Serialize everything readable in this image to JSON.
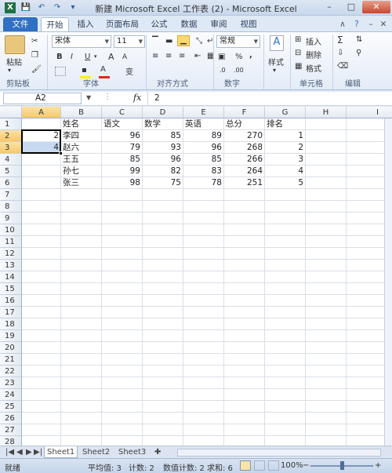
{
  "window": {
    "title": "新建 Microsoft Excel 工作表 (2) - Microsoft Excel"
  },
  "ribbon_tabs": [
    "文件",
    "开始",
    "插入",
    "页面布局",
    "公式",
    "数据",
    "审阅",
    "视图"
  ],
  "ribbon": {
    "paste_label": "粘贴",
    "font_name": "宋体",
    "font_size": "11",
    "bold": "B",
    "italic": "I",
    "underline": "U",
    "grow_font": "A",
    "shrink_font": "A",
    "font_color_glyph": "A",
    "wen": "变",
    "number_format": "常规",
    "percent": "%",
    "comma": ",",
    "style_label": "样式",
    "insert_label": "插入",
    "delete_label": "删除",
    "format_label": "格式",
    "sum_glyph": "Σ",
    "group_labels": {
      "clipboard": "剪贴板",
      "font": "字体",
      "alignment": "对齐方式",
      "number": "数字",
      "cells": "单元格",
      "editing": "编辑"
    }
  },
  "formula_bar": {
    "name_box": "A2",
    "fx": "fx",
    "value": "2"
  },
  "columns": [
    "A",
    "B",
    "C",
    "D",
    "E",
    "F",
    "G",
    "H",
    "I"
  ],
  "rows": [
    "1",
    "2",
    "3",
    "4",
    "5",
    "6",
    "7",
    "8",
    "9",
    "10",
    "11",
    "12",
    "13",
    "14",
    "15",
    "16",
    "17",
    "18",
    "19",
    "20",
    "21",
    "22",
    "23",
    "24",
    "25",
    "26",
    "27",
    "28"
  ],
  "cells": {
    "A2": "2",
    "A3": "4",
    "B1": "姓名",
    "C1": "语文",
    "D1": "数学",
    "E1": "英语",
    "F1": "总分",
    "G1": "排名",
    "B2": "李四",
    "C2": "96",
    "D2": "85",
    "E2": "89",
    "F2": "270",
    "G2": "1",
    "B3": "赵六",
    "C3": "79",
    "D3": "93",
    "E3": "96",
    "F3": "268",
    "G3": "2",
    "B4": "王五",
    "C4": "85",
    "D4": "96",
    "E4": "85",
    "F4": "266",
    "G4": "3",
    "B5": "孙七",
    "C5": "99",
    "D5": "82",
    "E5": "83",
    "F5": "264",
    "G5": "4",
    "B6": "张三",
    "C6": "98",
    "D6": "75",
    "E6": "78",
    "F6": "251",
    "G6": "5"
  },
  "sheet_tabs": [
    "Sheet1",
    "Sheet2",
    "Sheet3"
  ],
  "status": {
    "ready": "就绪",
    "average": "平均值: 3",
    "count": "计数: 2",
    "numeric_count": "数值计数: 2",
    "sum": "求和: 6",
    "zoom": "100%"
  },
  "colors": {
    "file_tab": "#2f6fc4",
    "selection": "#c6d9f1",
    "header_selected": "#f5c86b"
  }
}
